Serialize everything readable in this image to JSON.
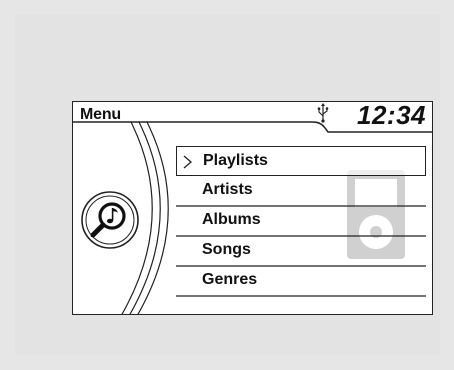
{
  "screen": {
    "title": "Menu",
    "clock": "12:34"
  },
  "status": {
    "usb_icon": "usb-icon"
  },
  "menu": {
    "items": [
      {
        "label": "Playlists",
        "selected": true
      },
      {
        "label": "Artists",
        "selected": false
      },
      {
        "label": "Albums",
        "selected": false
      },
      {
        "label": "Songs",
        "selected": false
      },
      {
        "label": "Genres",
        "selected": false
      }
    ]
  },
  "icons": {
    "music": "music-search-icon",
    "device": "ipod-icon",
    "selection": "chevron-right-icon"
  },
  "colors": {
    "frame": "#222222",
    "background": "#e6e6e6",
    "device_gray": "#d0d0d0"
  }
}
